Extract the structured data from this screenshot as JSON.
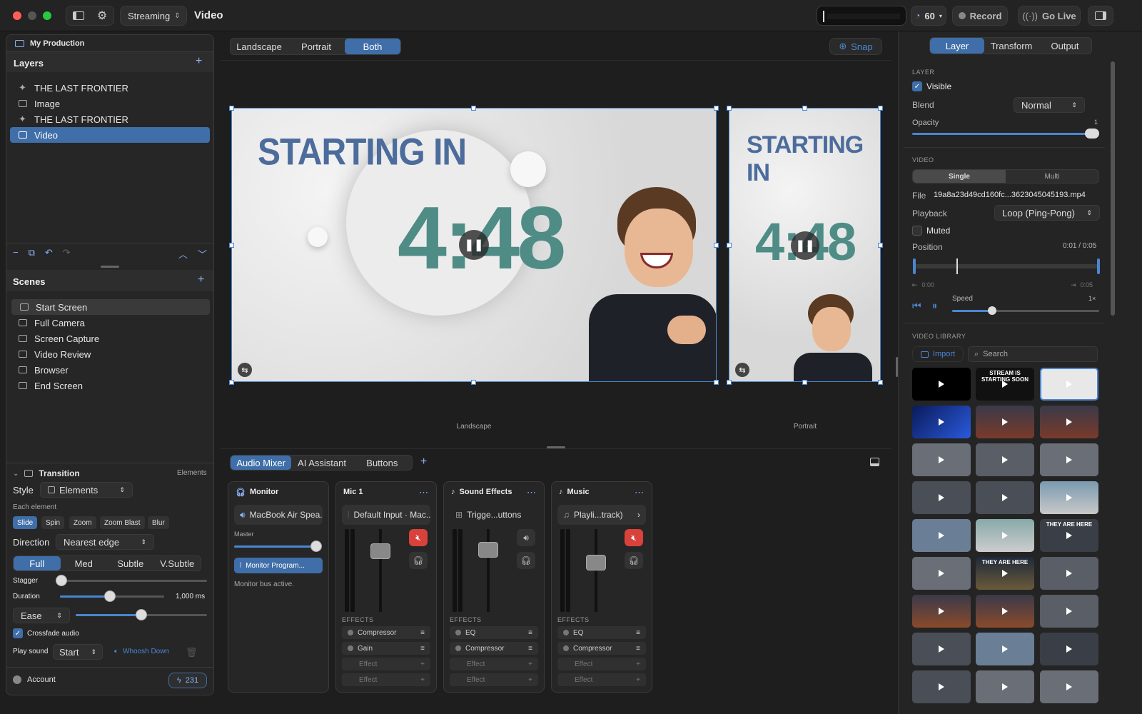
{
  "app": {
    "mode": "Streaming",
    "title": "Video",
    "fps": "60",
    "record": "Record",
    "go_live": "Go Live"
  },
  "left": {
    "production": "My Production",
    "layers_title": "Layers",
    "layers": [
      {
        "label": "THE LAST FRONTIER",
        "icon": "sparkle-icon"
      },
      {
        "label": "Image",
        "icon": "image-icon"
      },
      {
        "label": "THE LAST FRONTIER",
        "icon": "sparkle-icon"
      },
      {
        "label": "Video",
        "icon": "film-icon"
      }
    ],
    "scenes_title": "Scenes",
    "scenes": [
      "Start Screen",
      "Full Camera",
      "Screen Capture",
      "Video Review",
      "Browser",
      "End Screen"
    ],
    "transition": {
      "title": "Transition",
      "elements_label": "Elements",
      "style_label": "Style",
      "style_value": "Elements",
      "each_element": "Each element",
      "effects": [
        "Slide",
        "Spin",
        "Zoom",
        "Zoom Blast",
        "Blur"
      ],
      "direction_label": "Direction",
      "direction_value": "Nearest edge",
      "intensities": [
        "Full",
        "Med",
        "Subtle",
        "V.Subtle"
      ],
      "stagger_label": "Stagger",
      "duration_label": "Duration",
      "duration_value": "1,000 ms",
      "ease_value": "Ease",
      "crossfade_label": "Crossfade audio",
      "play_sound_label": "Play sound",
      "play_sound_value": "Start",
      "sound_name": "Whoosh Down"
    },
    "account": "Account",
    "credits": "231"
  },
  "canvas": {
    "tabs": [
      "Landscape",
      "Portrait",
      "Both"
    ],
    "snap": "Snap",
    "starting_text": "STARTING IN",
    "countdown": "4:48",
    "landscape_label": "Landscape",
    "portrait_label": "Portrait"
  },
  "bottom": {
    "tabs": [
      "Audio Mixer",
      "AI Assistant",
      "Buttons"
    ],
    "monitor": {
      "title": "Monitor",
      "device": "MacBook Air Spea...",
      "master": "Master",
      "program": "Monitor Program...",
      "status": "Monitor bus active."
    },
    "channels": [
      {
        "title": "Mic 1",
        "device": "Default Input · Mac...",
        "effects_label": "EFFECTS",
        "effects": [
          "Compressor",
          "Gain"
        ],
        "muted": true
      },
      {
        "title": "Sound Effects",
        "device": "Trigge...uttons",
        "effects_label": "EFFECTS",
        "effects": [
          "EQ",
          "Compressor"
        ],
        "muted": false
      },
      {
        "title": "Music",
        "device": "Playli...track)",
        "effects_label": "EFFECTS",
        "effects": [
          "EQ",
          "Compressor"
        ],
        "muted": true
      }
    ],
    "effect_placeholder": "Effect"
  },
  "right": {
    "tabs": [
      "Layer",
      "Transform",
      "Output"
    ],
    "layer_heading": "LAYER",
    "visible_label": "Visible",
    "blend_label": "Blend",
    "blend_value": "Normal",
    "opacity_label": "Opacity",
    "opacity_value": "1",
    "video_heading": "VIDEO",
    "video_modes": [
      "Single",
      "Multi"
    ],
    "file_label": "File",
    "file_value": "19a8a23d49cd160fc...3623045045193.mp4",
    "playback_label": "Playback",
    "playback_value": "Loop (Ping-Pong)",
    "muted_label": "Muted",
    "position_label": "Position",
    "position_value": "0:01 / 0:05",
    "in_time": "0:00",
    "out_time": "0:05",
    "speed_label": "Speed",
    "speed_value": "1×",
    "library_heading": "VIDEO LIBRARY",
    "import_label": "Import",
    "search_placeholder": "Search",
    "thumb_texts": [
      "STREAM IS STARTING SOON",
      "THEY ARE HERE",
      "THEY ARE HERE"
    ]
  }
}
